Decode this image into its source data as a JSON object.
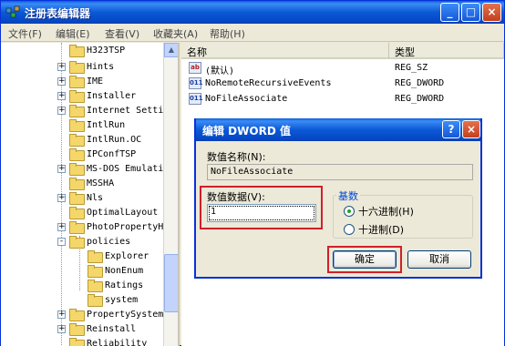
{
  "window": {
    "title": "注册表编辑器",
    "controls": {
      "minimize": "_",
      "maximize": "□",
      "close": "×"
    }
  },
  "menu": [
    "文件(F)",
    "编辑(E)",
    "查看(V)",
    "收藏夹(A)",
    "帮助(H)"
  ],
  "tree": {
    "items": [
      {
        "label": "H323TSP",
        "expander": ""
      },
      {
        "label": "Hints",
        "expander": "+"
      },
      {
        "label": "IME",
        "expander": "+"
      },
      {
        "label": "Installer",
        "expander": "+"
      },
      {
        "label": "Internet Setti",
        "expander": "+"
      },
      {
        "label": "IntlRun",
        "expander": ""
      },
      {
        "label": "IntlRun.OC",
        "expander": ""
      },
      {
        "label": "IPConfTSP",
        "expander": ""
      },
      {
        "label": "MS-DOS Emulati",
        "expander": "+"
      },
      {
        "label": "MSSHA",
        "expander": ""
      },
      {
        "label": "Nls",
        "expander": "+"
      },
      {
        "label": "OptimalLayout",
        "expander": ""
      },
      {
        "label": "PhotoPropertyH",
        "expander": "+"
      },
      {
        "label": "policies",
        "expander": "-"
      },
      {
        "label": "Explorer",
        "expander": ""
      },
      {
        "label": "NonEnum",
        "expander": ""
      },
      {
        "label": "Ratings",
        "expander": ""
      },
      {
        "label": "system",
        "expander": ""
      },
      {
        "label": "PropertySystem",
        "expander": "+"
      },
      {
        "label": "Reinstall",
        "expander": "+"
      },
      {
        "label": "Reliability",
        "expander": ""
      }
    ]
  },
  "list": {
    "columns": {
      "name": "名称",
      "type": "类型"
    },
    "rows": [
      {
        "icon": "ab",
        "name": "(默认)",
        "type": "REG_SZ"
      },
      {
        "icon": "011",
        "name": "NoRemoteRecursiveEvents",
        "type": "REG_DWORD"
      },
      {
        "icon": "011",
        "name": "NoFileAssociate",
        "type": "REG_DWORD"
      }
    ]
  },
  "dialog": {
    "title": "编辑 DWORD 值",
    "help": "?",
    "close": "×",
    "value_name_label": "数值名称(N):",
    "value_name": "NoFileAssociate",
    "value_data_label": "数值数据(V):",
    "value_data": "1",
    "base_label": "基数",
    "hex_label": "十六进制(H)",
    "dec_label": "十进制(D)",
    "base_selected": "hex",
    "ok_label": "确定",
    "cancel_label": "取消"
  },
  "colors": {
    "highlight_box": "#d0202a",
    "title_blue": "#0b59d6"
  }
}
